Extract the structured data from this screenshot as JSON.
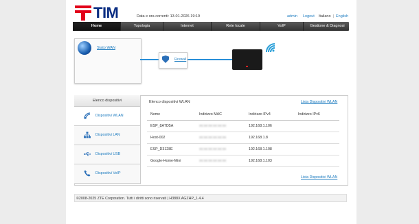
{
  "brand": {
    "name": "TIM"
  },
  "header": {
    "datetime_label": "Data e ora correnti: 13-01-2026 19:19",
    "user_link": "admin",
    "logout_link": "Logout",
    "lang_current": "Italiano",
    "lang_other": "English",
    "separator": "|"
  },
  "nav": [
    {
      "label": "Home",
      "active": true
    },
    {
      "label": "Topologia"
    },
    {
      "label": "Internet"
    },
    {
      "label": "Rete locale"
    },
    {
      "label": "VoIP"
    },
    {
      "label": "Gestione & Diagnosi"
    }
  ],
  "topology": {
    "wan_label": "Stato WAN",
    "firewall_label": "Firewall"
  },
  "sidebar": {
    "title": "Elenco dispositivi",
    "items": [
      {
        "label": "Dispositivi WLAN",
        "icon": "wifi-icon"
      },
      {
        "label": "Dispositivi LAN",
        "icon": "network-icon"
      },
      {
        "label": "Dispositivi USB",
        "icon": "usb-icon"
      },
      {
        "label": "Dispositivi VoIP",
        "icon": "phone-icon"
      }
    ]
  },
  "devices": {
    "title": "Elenco dispositivi WLAN",
    "list_link": "Lista Dispositivi WLAN",
    "columns": [
      "Nome",
      "Indirizzo MAC",
      "Indirizzo IPv4",
      "Indirizzo IPv6"
    ],
    "rows": [
      {
        "name": "ESP_8A7D5A",
        "mac": "xx:xx:xx:xx:xx:xx",
        "ipv4": "192.168.1.106",
        "ipv6": ""
      },
      {
        "name": "Host-002",
        "mac": "xx:xx:xx:xx:xx:xx",
        "ipv4": "192.168.1.8",
        "ipv6": ""
      },
      {
        "name": "ESP_D3128E",
        "mac": "xx:xx:xx:xx:xx:xx",
        "ipv4": "192.168.1.108",
        "ipv6": ""
      },
      {
        "name": "Google-Home-Mini",
        "mac": "xx:xx:xx:xx:xx:xx",
        "ipv4": "192.168.1.103",
        "ipv6": ""
      }
    ]
  },
  "footer": {
    "text": "©2008-2025 ZTE Corporation. Tutti i diritti sono riservati  |   H388X AGZHP_1.4.4"
  },
  "colors": {
    "brand_blue": "#0a2d82",
    "brand_red": "#e2001a",
    "link": "#1a7abf",
    "nav_bg": "#333333"
  }
}
